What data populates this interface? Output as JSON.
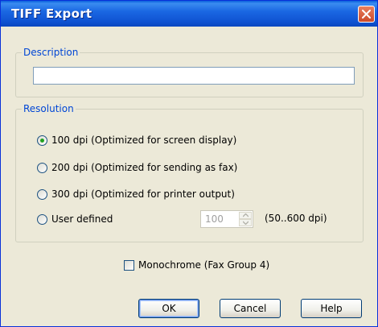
{
  "window": {
    "title": "TIFF Export"
  },
  "description": {
    "legend": "Description",
    "value": "",
    "placeholder": ""
  },
  "resolution": {
    "legend": "Resolution",
    "options": [
      {
        "label": "100 dpi (Optimized for screen display)",
        "selected": true
      },
      {
        "label": "200 dpi (Optimized for sending as fax)",
        "selected": false
      },
      {
        "label": "300 dpi (Optimized for printer output)",
        "selected": false
      },
      {
        "label": "User defined",
        "selected": false
      }
    ],
    "user_dpi_value": "100",
    "range_label": "(50..600 dpi)"
  },
  "monochrome": {
    "label": "Monochrome (Fax Group 4)",
    "checked": false
  },
  "buttons": {
    "ok": "OK",
    "cancel": "Cancel",
    "help": "Help"
  }
}
